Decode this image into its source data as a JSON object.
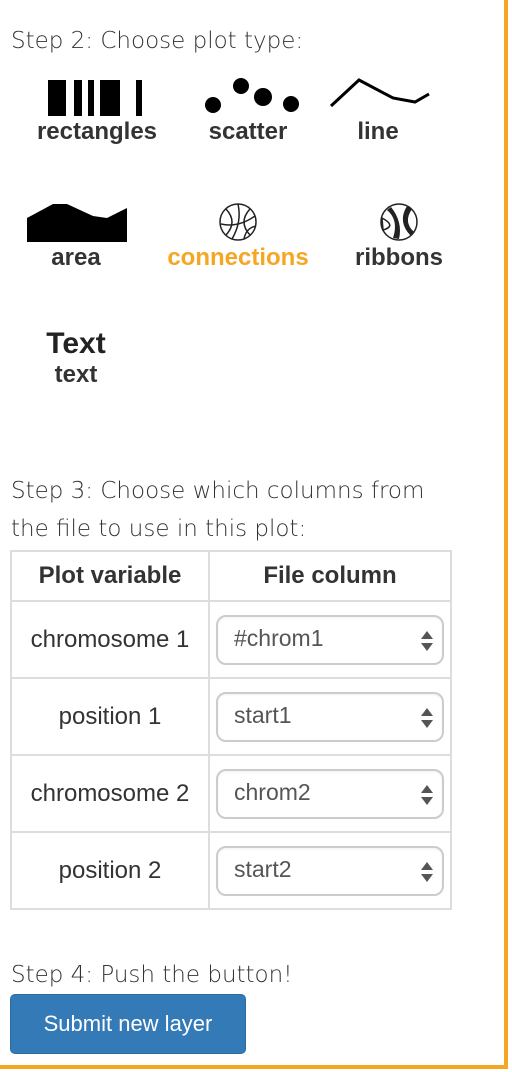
{
  "step2": {
    "label": "Step 2: Choose plot type:"
  },
  "plot_types": [
    {
      "label": "rectangles",
      "icon": "rectangles-icon"
    },
    {
      "label": "scatter",
      "icon": "scatter-icon"
    },
    {
      "label": "line",
      "icon": "line-icon"
    },
    {
      "label": "area",
      "icon": "area-icon"
    },
    {
      "label": "connections",
      "icon": "connections-icon",
      "selected": true
    },
    {
      "label": "ribbons",
      "icon": "ribbons-icon"
    },
    {
      "label": "text",
      "icon_text": "Text"
    }
  ],
  "step3": {
    "label_line1": "Step 3: Choose which columns from",
    "label_line2": "the file to use in this plot:"
  },
  "table": {
    "headers": [
      "Plot variable",
      "File column"
    ],
    "rows": [
      {
        "variable": "chromosome 1",
        "column": "#chrom1"
      },
      {
        "variable": "position 1",
        "column": "start1"
      },
      {
        "variable": "chromosome 2",
        "column": "chrom2"
      },
      {
        "variable": "position 2",
        "column": "start2"
      }
    ]
  },
  "step4": {
    "label": "Step 4: Push the button!"
  },
  "submit": {
    "label": "Submit new layer"
  },
  "colors": {
    "accent": "#f5a623",
    "primary": "#337ab7",
    "text": "#333333"
  }
}
